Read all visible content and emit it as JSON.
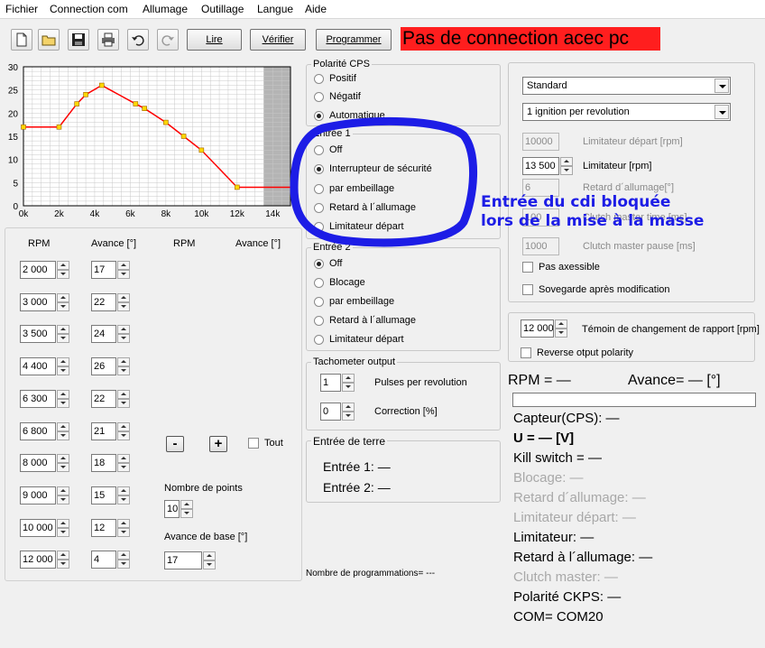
{
  "menu": [
    "Fichier",
    "Connection com",
    "Allumage",
    "Outillage",
    "Langue",
    "Aide"
  ],
  "toolbar": {
    "icons": [
      "new-file-icon",
      "open-folder-icon",
      "save-icon",
      "print-icon",
      "undo-icon",
      "redo-icon"
    ],
    "lire": "Lire",
    "verifier": "Vérifier",
    "programmer": "Programmer"
  },
  "status_banner": "Pas de connection acec pc",
  "chart_data": {
    "type": "line",
    "x": [
      0,
      2000,
      3000,
      3500,
      4400,
      6300,
      6800,
      8000,
      9000,
      10000,
      12000,
      15000
    ],
    "y": [
      17,
      17,
      22,
      24,
      26,
      22,
      21,
      18,
      15,
      12,
      4,
      4
    ],
    "marker_count": 11,
    "xlim": [
      0,
      15000
    ],
    "ylim": [
      0,
      30
    ],
    "x_ticks": [
      "0k",
      "2k",
      "4k",
      "6k",
      "8k",
      "10k",
      "12k",
      "14k"
    ],
    "y_ticks": [
      "0",
      "5",
      "10",
      "15",
      "20",
      "25",
      "30"
    ],
    "shaded_from": 13500,
    "grid": true,
    "line_color": "#ff0000",
    "marker_color": "#ffd700"
  },
  "table": {
    "headers": [
      "RPM",
      "Avance [°]",
      "RPM",
      "Avance [°]"
    ],
    "rows": [
      {
        "rpm": "2 000",
        "avance": "17"
      },
      {
        "rpm": "3 000",
        "avance": "22"
      },
      {
        "rpm": "3 500",
        "avance": "24"
      },
      {
        "rpm": "4 400",
        "avance": "26"
      },
      {
        "rpm": "6 300",
        "avance": "22"
      },
      {
        "rpm": "6 800",
        "avance": "21"
      },
      {
        "rpm": "8 000",
        "avance": "18"
      },
      {
        "rpm": "9 000",
        "avance": "15"
      },
      {
        "rpm": "10 000",
        "avance": "12"
      },
      {
        "rpm": "12 000",
        "avance": "4"
      }
    ],
    "minus": "-",
    "plus": "+",
    "tout": "Tout",
    "nb_points_label": "Nombre de points",
    "nb_points": "10",
    "avance_base_label": "Avance de base [°]",
    "avance_base": "17"
  },
  "polarite": {
    "title": "Polarité CPS",
    "options": [
      "Positif",
      "Négatif",
      "Automatique"
    ],
    "selected": 2
  },
  "entree1": {
    "title": "Entrée 1",
    "options": [
      "Off",
      "Interrupteur de sécurité",
      "par embeillage",
      "Retard à l´allumage",
      "Limitateur départ"
    ],
    "selected": 1
  },
  "entree2": {
    "title": "Entrée 2",
    "options": [
      "Off",
      "Blocage",
      "par embeillage",
      "Retard à l´allumage",
      "Limitateur départ"
    ],
    "selected": 0
  },
  "tacho": {
    "title": "Tachometer output",
    "pulses": "1",
    "pulses_label": "Pulses per revolution",
    "correction": "0",
    "correction_label": "Correction [%]"
  },
  "terre": {
    "title": "Entrée de terre",
    "e1": "Entrée 1: —",
    "e2": "Entrée 2: —"
  },
  "nb_prog": "Nombre de programmations=  ---",
  "settings": {
    "mode": "Standard",
    "ignition": "1 ignition per revolution",
    "lim_depart_val": "10000",
    "lim_depart_label": "Limitateur départ [rpm]",
    "limitateur_val": "13 500",
    "limitateur_label": "Limitateur [rpm]",
    "retard_val": "6",
    "retard_label": "Retard d´allumage[°]",
    "clutch_time_val": "100",
    "clutch_time_label": "Clutch master time [ms]",
    "clutch_pause_val": "1000",
    "clutch_pause_label": "Clutch master pause [ms]",
    "pas_axessible": "Pas axessible",
    "sovegarde": "Sovegarde après modification"
  },
  "rapport": {
    "value": "12 000",
    "label": "Témoin de changement de rapport [rpm]",
    "reverse": "Reverse otput polarity"
  },
  "live": {
    "rpm": "RPM = —",
    "avance": "Avance= — [°]",
    "progress": 0,
    "capteur": "Capteur(CPS): —",
    "u": "U = — [V]",
    "kill": "Kill switch = —",
    "blocage": "Blocage: —",
    "retard_all": "Retard d´allumage: —",
    "lim_depart": "Limitateur départ: —",
    "limitateur": "Limitateur: —",
    "retard_a": "Retard à l´allumage: —",
    "clutch": "Clutch master: —",
    "polarite": "Polarité CKPS: —",
    "com": "COM= COM20"
  },
  "annotation": {
    "line1": "Entrée du cdi bloquée",
    "line2": "lors de la mise à la masse",
    "color": "#1d1de6"
  }
}
